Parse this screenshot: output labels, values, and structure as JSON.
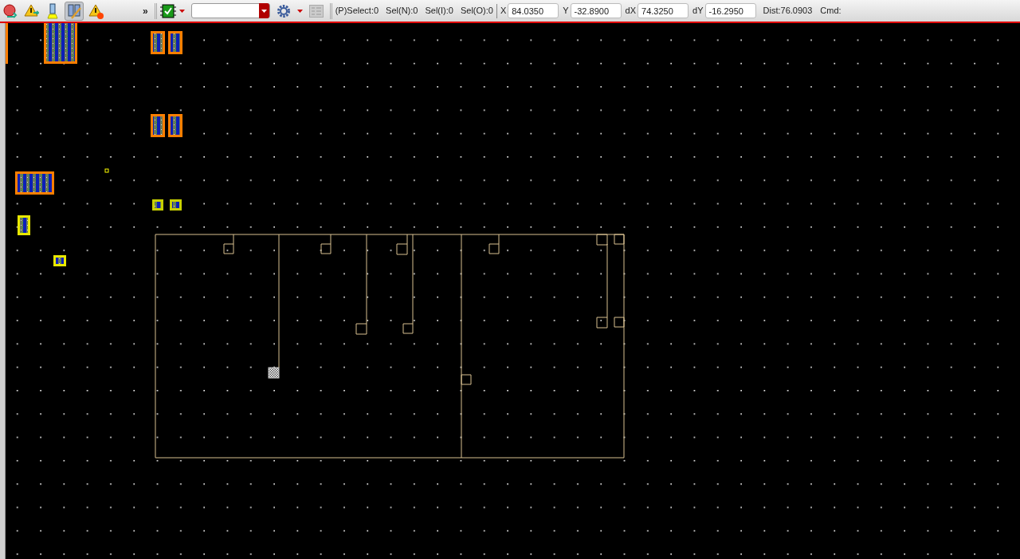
{
  "toolbar": {
    "tool_buttons": [
      {
        "selected": false
      },
      {
        "selected": false
      },
      {
        "selected": false
      },
      {
        "selected": true
      },
      {
        "selected": false
      }
    ],
    "overflow": "»",
    "status": [
      {
        "kind": "count",
        "text": "(P)Select:0"
      },
      {
        "kind": "count",
        "text": "Sel(N):0"
      },
      {
        "kind": "count",
        "text": "Sel(I):0"
      },
      {
        "kind": "count",
        "text": "Sel(O):0"
      }
    ],
    "coordinates": [
      {
        "label": "X",
        "value": "84.0350"
      },
      {
        "label": "Y",
        "value": "-32.8900"
      },
      {
        "label": "dX",
        "value": "74.3250"
      },
      {
        "label": "dY",
        "value": "-16.2950"
      }
    ],
    "distance": "Dist:76.0903",
    "command": "Cmd:"
  }
}
